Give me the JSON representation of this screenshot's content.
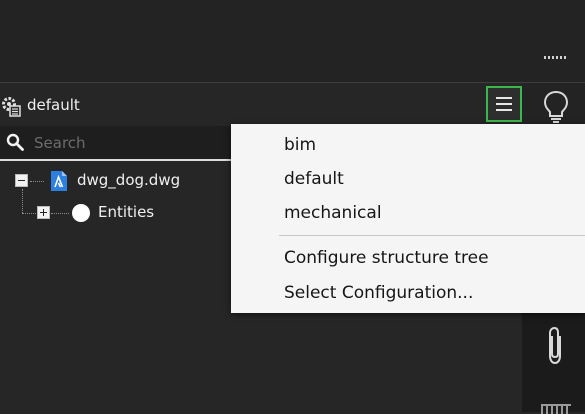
{
  "toolbar": {
    "config_name": "default",
    "menu_button_label": "Menu"
  },
  "search": {
    "value": "",
    "placeholder": "Search"
  },
  "tree": {
    "file_name": "dwg_dog.dwg",
    "child_label": "Entities"
  },
  "dropdown": {
    "configs": [
      "bim",
      "default",
      "mechanical"
    ],
    "actions": [
      "Configure structure tree",
      "Select Configuration..."
    ]
  },
  "colors": {
    "accent_focus": "#3bb84a",
    "panel_bg": "#262626",
    "menu_bg": "#f5f5f5",
    "dwg_icon_blue": "#2d7fe0"
  },
  "icons": {
    "settings": "gear-icon",
    "menu": "hamburger-icon",
    "search": "search-icon",
    "file": "dwg-file-icon",
    "node": "circle-node-icon",
    "rail_top": "lightbulb-icon",
    "rail_mid": "paperclip-icon"
  }
}
